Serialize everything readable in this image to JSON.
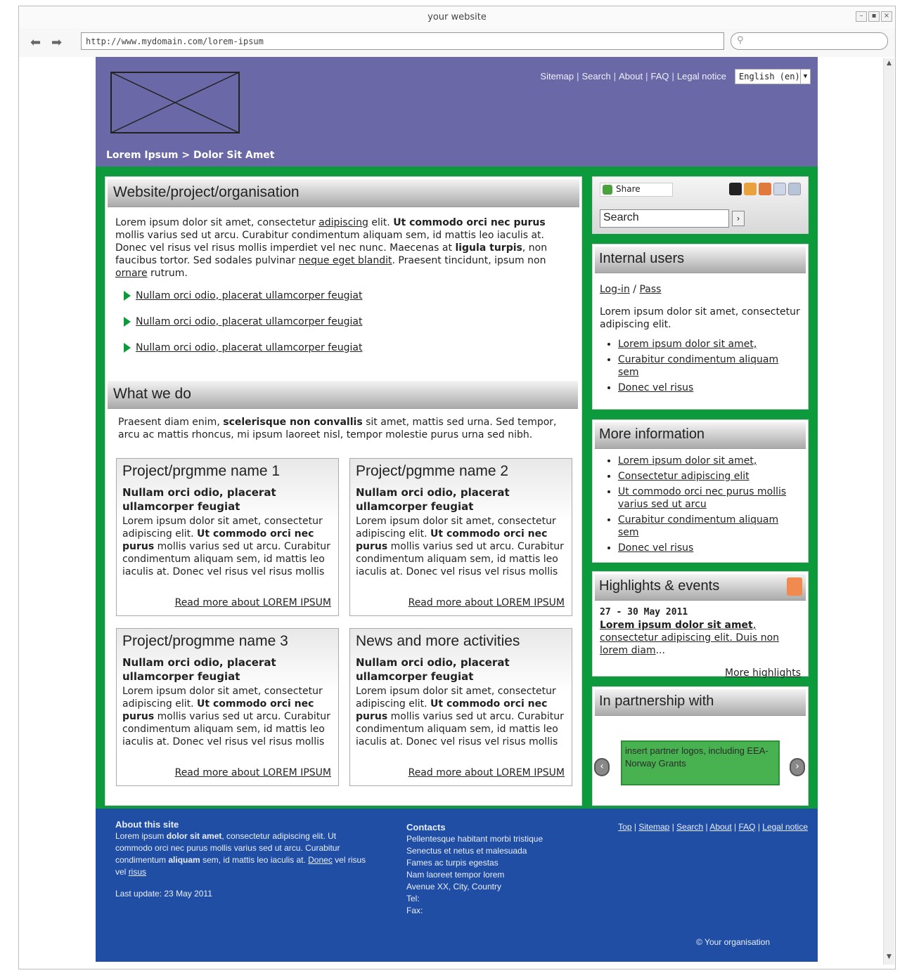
{
  "browser": {
    "title": "your website",
    "url": "http://www.mydomain.com/lorem-ipsum",
    "controls": [
      "–",
      "▪",
      "×"
    ],
    "back_icon": "back-arrow-icon",
    "forward_icon": "forward-arrow-icon"
  },
  "header": {
    "topnav": [
      "Sitemap",
      "Search",
      "About",
      "FAQ",
      "Legal notice"
    ],
    "language": "English (en)",
    "breadcrumb": "Lorem Ipsum > Dolor Sit Amet"
  },
  "main": {
    "section1_title": "Website/project/organisation",
    "intro": {
      "p1": "Lorem ipsum dolor sit amet, consectetur ",
      "link1": "adipiscing",
      "p2": " elit. ",
      "bold1": "Ut commodo orci nec purus",
      "p3": " mollis varius sed ut arcu. Curabitur condimentum aliquam sem, id mattis leo iaculis at. Donec vel risus vel risus mollis imperdiet vel nec nunc. Maecenas at ",
      "bold2": "ligula turpis",
      "p4": ", non faucibus tortor. Sed sodales pulvinar ",
      "link2": "neque eget blandit",
      "p5": ". Praesent tincidunt, ipsum non ",
      "link3": "ornare",
      "p6": " rutrum."
    },
    "arrow_links": [
      "Nullam orci odio, placerat ullamcorper feugiat",
      "Nullam orci odio, placerat ullamcorper feugiat",
      "Nullam orci odio, placerat ullamcorper feugiat"
    ],
    "section2_title": "What we do",
    "wwd": {
      "p1": "Praesent diam enim, ",
      "bold": "scelerisque non convallis",
      "p2": " sit amet, mattis sed urna. Sed tempor, arcu ac mattis rhoncus, mi ipsum laoreet nisl, tempor molestie purus urna sed nibh."
    },
    "cards": [
      {
        "title": "Project/prgmme name 1",
        "sub": "Nullam orci odio, placerat ullamcorper feugiat",
        "t1": "Lorem ipsum dolor sit amet, consectetur adipiscing elit. ",
        "bold": "Ut commodo orci nec purus",
        "t2": " mollis varius sed ut arcu. Curabitur condimentum aliquam sem, id mattis leo iaculis at. Donec vel risus vel risus mollis",
        "more": "Read more about LOREM IPSUM"
      },
      {
        "title": "Project/pgmme name 2",
        "sub": "Nullam orci odio, placerat ullamcorper feugiat",
        "t1": "Lorem ipsum dolor sit amet, consectetur adipiscing elit. ",
        "bold": "Ut commodo orci nec purus",
        "t2": " mollis varius sed ut arcu. Curabitur condimentum aliquam sem, id mattis leo iaculis at. Donec vel risus vel risus mollis",
        "more": "Read more about LOREM IPSUM"
      },
      {
        "title": "Project/progmme name 3",
        "sub": "Nullam orci odio, placerat ullamcorper feugiat",
        "t1": "Lorem ipsum dolor sit amet, consectetur adipiscing elit. ",
        "bold": "Ut commodo orci nec purus",
        "t2": " mollis varius sed ut arcu. Curabitur condimentum aliquam sem, id mattis leo iaculis at. Donec vel risus vel risus mollis",
        "more": "Read more about LOREM IPSUM"
      },
      {
        "title": "News and more activities",
        "sub": "Nullam orci odio, placerat ullamcorper feugiat",
        "t1": "Lorem ipsum dolor sit amet, consectetur adipiscing elit. ",
        "bold": "Ut commodo orci nec purus",
        "t2": " mollis varius sed ut arcu. Curabitur condimentum aliquam sem, id mattis leo iaculis at. Donec vel risus vel risus mollis",
        "more": "Read more about LOREM IPSUM"
      }
    ]
  },
  "sidebar": {
    "share_label": "Share",
    "search_placeholder": "Search",
    "search_go": "›",
    "internal": {
      "title": "Internal users",
      "login": "Log-in",
      "slash": " / ",
      "pass": "Pass",
      "text": "Lorem ipsum dolor sit amet, consectetur adipiscing elit.",
      "links": [
        "Lorem ipsum dolor sit amet,",
        "Curabitur condimentum aliquam sem",
        "Donec vel risus"
      ]
    },
    "more_info": {
      "title": "More information",
      "links": [
        "Lorem ipsum dolor sit amet,",
        "Consectetur adipiscing elit",
        "Ut commodo orci nec purus mollis varius sed ut arcu",
        "Curabitur condimentum aliquam sem",
        "Donec vel risus"
      ]
    },
    "highlights": {
      "title": "Highlights & events",
      "date": "27 - 30 May 2011",
      "bold_link": "Lorem ipsum dolor sit amet",
      "rest": ", consectetur adipiscing elit. Duis non lorem diam",
      "ellipsis": "...",
      "more": "More highlights"
    },
    "partnership": {
      "title": "In partnership with",
      "placeholder": "insert partner logos, including EEA-Norway Grants",
      "prev": "‹",
      "next": "›"
    }
  },
  "footer": {
    "about_title": "About this site",
    "about": {
      "t1": "Lorem ipsum ",
      "b1": "dolor sit amet",
      "t2": ", consectetur adipiscing elit. Ut commodo orci nec purus mollis varius sed ut arcu. Curabitur condimentum ",
      "b2": "aliquam",
      "t3": " sem, id mattis leo iaculis at. ",
      "l1": "Donec",
      "t4": " vel risus vel ",
      "l2": "risus"
    },
    "last_update": "Last update: 23 May 2011",
    "contacts_title": "Contacts",
    "contacts": [
      "Pellentesque habitant morbi tristique",
      "Senectus et netus et malesuada",
      "Fames ac turpis egestas",
      "Nam laoreet tempor lorem",
      "Avenue XX, City, Country",
      "Tel:",
      "Fax:"
    ],
    "links": [
      "Top",
      "Sitemap",
      "Search",
      "About",
      "FAQ",
      "Legal notice"
    ],
    "copyright": "© Your organisation"
  },
  "colors": {
    "header": "#6a68a6",
    "green": "#0c9a3c",
    "footer": "#1f4ea4"
  }
}
